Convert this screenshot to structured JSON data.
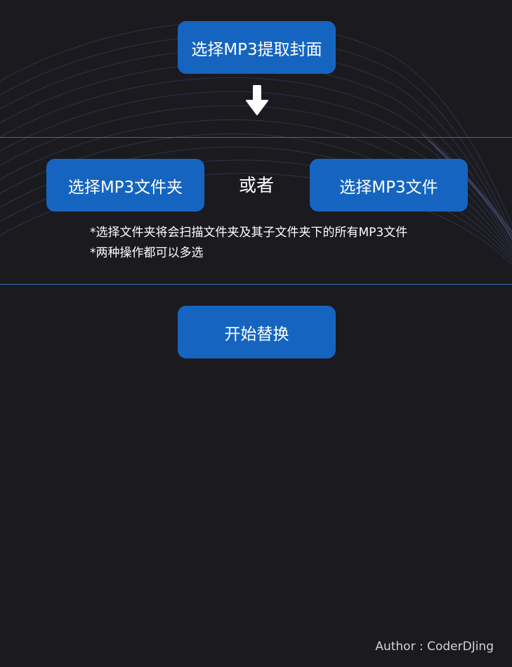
{
  "buttons": {
    "extract_cover": "选择MP3提取封面",
    "select_folder": "选择MP3文件夹",
    "select_file": "选择MP3文件",
    "start_replace": "开始替换"
  },
  "or_label": "或者",
  "notes": [
    "*选择文件夹将会扫描文件夹及其子文件夹下的所有MP3文件",
    "*两种操作都可以多选"
  ],
  "author": "Author : CoderDJing",
  "icons": {
    "arrow": "arrow-down-icon"
  },
  "colors": {
    "background": "#1b1a1f",
    "button": "#1565c0",
    "divider": "#2f6fb4",
    "text": "#ffffff"
  }
}
